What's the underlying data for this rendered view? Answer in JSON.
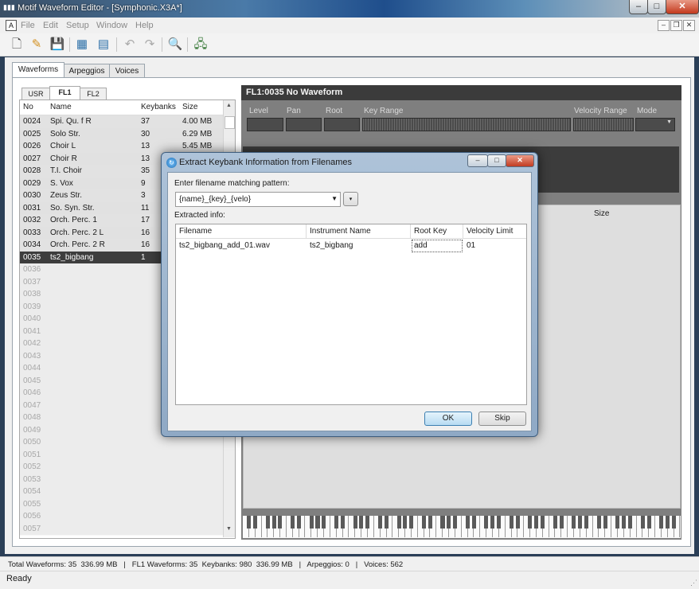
{
  "window": {
    "title": "Motif Waveform Editor - [Symphonic.X3A*]",
    "app_icon": "waveform-app-icon",
    "caption_buttons": [
      "minimize",
      "maximize",
      "close"
    ]
  },
  "menu": {
    "items": [
      "File",
      "Edit",
      "Setup",
      "Window",
      "Help"
    ],
    "doc_icon_label": "A"
  },
  "toolbar": {
    "icons": [
      "new-file-icon",
      "open-folder-icon",
      "save-icon",
      "import-icon",
      "export-icon",
      "undo-icon",
      "redo-icon",
      "search-icon",
      "device-icon"
    ]
  },
  "tabs": [
    "Waveforms",
    "Arpeggios",
    "Voices"
  ],
  "banks": [
    "USR",
    "FL1",
    "FL2"
  ],
  "waveform_list": {
    "columns": [
      "No",
      "Name",
      "Keybanks",
      "Size"
    ],
    "rows": [
      {
        "no": "0024",
        "name": "Spi. Qu. f R",
        "keybanks": "37",
        "size": "4.00 MB"
      },
      {
        "no": "0025",
        "name": "Solo Str.",
        "keybanks": "30",
        "size": "6.29 MB"
      },
      {
        "no": "0026",
        "name": "Choir L",
        "keybanks": "13",
        "size": "5.45 MB"
      },
      {
        "no": "0027",
        "name": "Choir R",
        "keybanks": "13",
        "size": ""
      },
      {
        "no": "0028",
        "name": "T.I. Choir",
        "keybanks": "35",
        "size": ""
      },
      {
        "no": "0029",
        "name": "S. Vox",
        "keybanks": "9",
        "size": ""
      },
      {
        "no": "0030",
        "name": "Zeus Str.",
        "keybanks": "3",
        "size": ""
      },
      {
        "no": "0031",
        "name": "So. Syn. Str.",
        "keybanks": "11",
        "size": ""
      },
      {
        "no": "0032",
        "name": "Orch. Perc. 1",
        "keybanks": "17",
        "size": ""
      },
      {
        "no": "0033",
        "name": "Orch. Perc. 2 L",
        "keybanks": "16",
        "size": ""
      },
      {
        "no": "0034",
        "name": "Orch. Perc. 2 R",
        "keybanks": "16",
        "size": ""
      },
      {
        "no": "0035",
        "name": "ts2_bigbang",
        "keybanks": "1",
        "size": ""
      }
    ],
    "selected_no": "0035",
    "empty_rows": [
      "0036",
      "0037",
      "0038",
      "0039",
      "0040",
      "0041",
      "0042",
      "0043",
      "0044",
      "0045",
      "0046",
      "0047",
      "0048",
      "0049",
      "0050",
      "0051",
      "0052",
      "0053",
      "0054",
      "0055",
      "0056",
      "0057"
    ]
  },
  "waveform_panel": {
    "header": "FL1:0035 No Waveform",
    "params": [
      "Level",
      "Pan",
      "Root",
      "Key Range",
      "Velocity Range",
      "Mode"
    ],
    "list_size_header": "Size"
  },
  "dialog": {
    "title": "Extract Keybank Information from Filenames",
    "pattern_label": "Enter filename matching pattern:",
    "pattern_value": "{name}_{key}_{velo}",
    "extracted_label": "Extracted info:",
    "columns": [
      "Filename",
      "Instrument Name",
      "Root Key",
      "Velocity Limit"
    ],
    "rows": [
      {
        "filename": "ts2_bigbang_add_01.wav",
        "instrument": "ts2_bigbang",
        "root_key": "add",
        "velocity": "01"
      }
    ],
    "ok_label": "OK",
    "skip_label": "Skip"
  },
  "status": {
    "summary": "Total Waveforms: 35  336.99 MB   |   FL1 Waveforms: 35  Keybanks: 980  336.99 MB   |   Arpeggios: 0   |   Voices: 562",
    "ready": "Ready"
  }
}
